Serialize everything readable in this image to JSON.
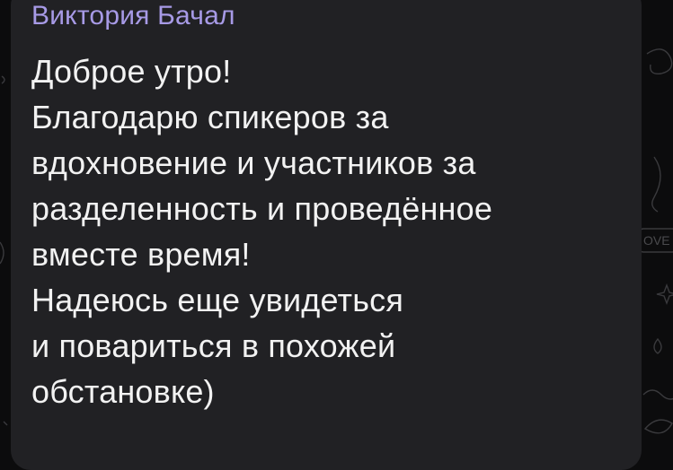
{
  "message": {
    "sender_name": "Виктория Бачал",
    "lines": [
      "Доброе утро!",
      "Благодарю спикеров за",
      "вдохновение и участников за",
      "разделенность и проведённое",
      "вместе время!",
      "Надеюсь еще увидеться",
      "и повариться в похожей",
      "обстановке)"
    ]
  },
  "wallpaper": {
    "doodle_text": "OVE",
    "background_color": "#0c0c0d",
    "bubble_color": "#212124",
    "sender_color": "#a79ae6",
    "text_color": "#f2f2f2"
  }
}
